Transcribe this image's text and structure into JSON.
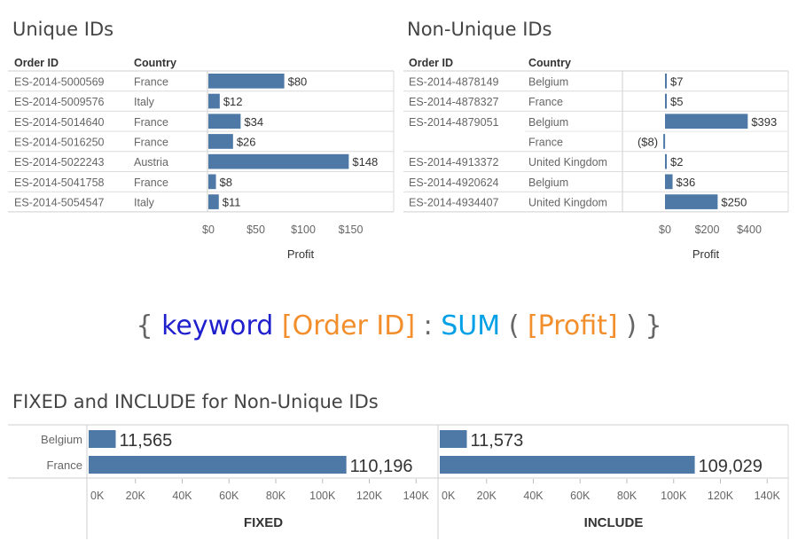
{
  "unique_title": "Unique IDs",
  "nonunique_title": "Non-Unique IDs",
  "bottom_title": "FIXED and INCLUDE for Non-Unique IDs",
  "formula": {
    "open": "{",
    "keyword": "keyword",
    "dim": "[Order ID]",
    "colon": ":",
    "agg": "SUM",
    "lparen": "(",
    "measure": "[Profit]",
    "rparen": ")",
    "close": "}"
  },
  "colors": {
    "bar": "#4e79a7",
    "keyword": "#1f1fce",
    "field": "#f28e2b",
    "agg": "#00a0e6",
    "brace": "#666666"
  },
  "chart_data": [
    {
      "type": "bar",
      "name": "unique",
      "headers": [
        "Order ID",
        "Country"
      ],
      "rows": [
        {
          "id": "ES-2014-5000569",
          "country": "France",
          "value": 80,
          "label": "$80"
        },
        {
          "id": "ES-2014-5009576",
          "country": "Italy",
          "value": 12,
          "label": "$12"
        },
        {
          "id": "ES-2014-5014640",
          "country": "France",
          "value": 34,
          "label": "$34"
        },
        {
          "id": "ES-2014-5016250",
          "country": "France",
          "value": 26,
          "label": "$26"
        },
        {
          "id": "ES-2014-5022243",
          "country": "Austria",
          "value": 148,
          "label": "$148"
        },
        {
          "id": "ES-2014-5041758",
          "country": "France",
          "value": 8,
          "label": "$8"
        },
        {
          "id": "ES-2014-5054547",
          "country": "Italy",
          "value": 11,
          "label": "$11"
        }
      ],
      "ticks": [
        0,
        50,
        100,
        150
      ],
      "tick_labels": [
        "$0",
        "$50",
        "$100",
        "$150"
      ],
      "xlabel": "Profit"
    },
    {
      "type": "bar",
      "name": "non-unique",
      "headers": [
        "Order ID",
        "Country"
      ],
      "rows": [
        {
          "id": "ES-2014-4878149",
          "country": "Belgium",
          "value": 7,
          "label": "$7"
        },
        {
          "id": "ES-2014-4878327",
          "country": "France",
          "value": 5,
          "label": "$5"
        },
        {
          "id": "ES-2014-4879051",
          "country": "Belgium",
          "value": 393,
          "label": "$393"
        },
        {
          "id": "",
          "country": "France",
          "value": -8,
          "label": "($8)"
        },
        {
          "id": "ES-2014-4913372",
          "country": "United Kingdom",
          "value": 2,
          "label": "$2"
        },
        {
          "id": "ES-2014-4920624",
          "country": "Belgium",
          "value": 36,
          "label": "$36"
        },
        {
          "id": "ES-2014-4934407",
          "country": "United Kingdom",
          "value": 250,
          "label": "$250"
        }
      ],
      "ticks": [
        0,
        200,
        400
      ],
      "tick_labels": [
        "$0",
        "$200",
        "$400"
      ],
      "xlabel": "Profit"
    },
    {
      "type": "bar",
      "name": "fixed-include",
      "categories": [
        "Belgium",
        "France"
      ],
      "series": [
        {
          "name": "FIXED",
          "values": [
            11565,
            110196
          ],
          "labels": [
            "11,565",
            "110,196"
          ]
        },
        {
          "name": "INCLUDE",
          "values": [
            11573,
            109029
          ],
          "labels": [
            "11,573",
            "109,029"
          ]
        }
      ],
      "ticks": [
        0,
        20000,
        40000,
        60000,
        80000,
        100000,
        120000,
        140000
      ],
      "tick_labels": [
        "0K",
        "20K",
        "40K",
        "60K",
        "80K",
        "100K",
        "120K",
        "140K"
      ]
    }
  ]
}
